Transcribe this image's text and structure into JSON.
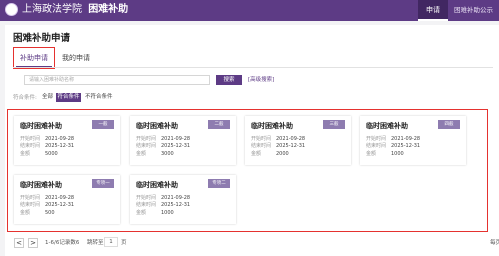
{
  "header": {
    "logo_text": "上海政法学院",
    "system_name": "困难补助",
    "nav": [
      {
        "label": "申请"
      },
      {
        "label": "困难补助公示"
      }
    ]
  },
  "page": {
    "title": "困难补助申请",
    "tabs": [
      {
        "label": "补助申请"
      },
      {
        "label": "我的申请"
      }
    ]
  },
  "search": {
    "placeholder": "请输入困难补助名称",
    "button_label": "搜索",
    "advanced_label": "[高级搜索]"
  },
  "filter": {
    "label": "符合条件:",
    "options": [
      "全部",
      "符合条件",
      "不符合条件"
    ],
    "selected": "符合条件"
  },
  "card_labels": {
    "start": "开始时间",
    "end": "结束时间",
    "amount": "金额"
  },
  "cards": [
    {
      "title": "临时困难补助",
      "badge": "一般",
      "start": "2021-09-28",
      "end": "2025-12-31",
      "amount": "5000"
    },
    {
      "title": "临时困难补助",
      "badge": "二般",
      "start": "2021-09-28",
      "end": "2025-12-31",
      "amount": "3000"
    },
    {
      "title": "临时困难补助",
      "badge": "三般",
      "start": "2021-09-28",
      "end": "2025-12-31",
      "amount": "2000"
    },
    {
      "title": "临时困难补助",
      "badge": "四般",
      "start": "2021-09-28",
      "end": "2025-12-31",
      "amount": "1000"
    },
    {
      "title": "临时困难补助",
      "badge": "专项一",
      "start": "2021-09-28",
      "end": "2025-12-31",
      "amount": "500"
    },
    {
      "title": "临时困难补助",
      "badge": "专项二",
      "start": "2021-09-28",
      "end": "2025-12-31",
      "amount": "1000"
    }
  ],
  "pagination": {
    "prev": "<",
    "next": ">",
    "info": "1-6/6记录数6",
    "goto_label": "跳转至",
    "current_page": "1",
    "page_unit": "页",
    "right_text": "每页"
  },
  "colors": {
    "brand": "#5d3b85",
    "highlight": "#e5322f"
  }
}
